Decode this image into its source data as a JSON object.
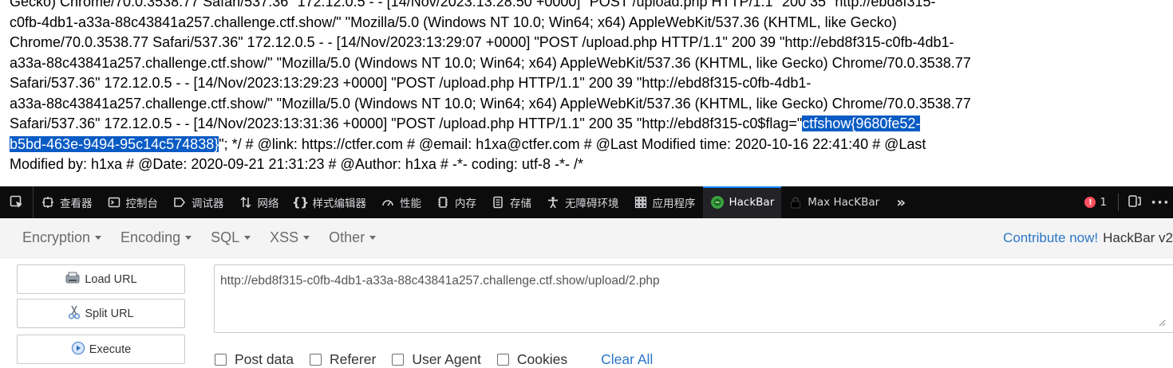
{
  "log": {
    "lines": [
      {
        "text": "Gecko) Chrome/70.0.3538.77 Safari/537.36\" 172.12.0.5 - - [14/Nov/2023:13:28:50 +0000] \"POST /upload.php HTTP/1.1\" 200 35 \"http://ebd8f315-"
      },
      {
        "text": "c0fb-4db1-a33a-88c43841a257.challenge.ctf.show/\" \"Mozilla/5.0 (Windows NT 10.0; Win64; x64) AppleWebKit/537.36 (KHTML, like Gecko)"
      },
      {
        "text": "Chrome/70.0.3538.77 Safari/537.36\" 172.12.0.5 - - [14/Nov/2023:13:29:07 +0000] \"POST /upload.php HTTP/1.1\" 200 39 \"http://ebd8f315-c0fb-4db1-"
      },
      {
        "text": "a33a-88c43841a257.challenge.ctf.show/\" \"Mozilla/5.0 (Windows NT 10.0; Win64; x64) AppleWebKit/537.36 (KHTML, like Gecko) Chrome/70.0.3538.77"
      },
      {
        "text": "Safari/537.36\" 172.12.0.5 - - [14/Nov/2023:13:29:23 +0000] \"POST /upload.php HTTP/1.1\" 200 39 \"http://ebd8f315-c0fb-4db1-"
      },
      {
        "text": "a33a-88c43841a257.challenge.ctf.show/\" \"Mozilla/5.0 (Windows NT 10.0; Win64; x64) AppleWebKit/537.36 (KHTML, like Gecko) Chrome/70.0.3538.77"
      },
      {
        "text": "Safari/537.36\" 172.12.0.5 - - [14/Nov/2023:13:31:36 +0000] \"POST /upload.php HTTP/1.1\" 200 35 \"http://ebd8f315-c0$flag=\"",
        "selected": "ctfshow{9680fe52-"
      },
      {
        "text": "",
        "selected": "b5bd-463e-9494-95c14c574838}",
        "after": "\"; */ # @link: https://ctfer.com # @email: h1xa@ctfer.com # @Last Modified time: 2020-10-16 22:41:40 # @Last"
      },
      {
        "text": "Modified by: h1xa # @Date: 2020-09-21 21:31:23 # @Author: h1xa # -*- coding: utf-8 -*- /*"
      }
    ]
  },
  "devtools": {
    "tabs": [
      {
        "label": "查看器",
        "icon": "inspector-icon"
      },
      {
        "label": "控制台",
        "icon": "console-icon"
      },
      {
        "label": "调试器",
        "icon": "debugger-icon"
      },
      {
        "label": "网络",
        "icon": "network-icon"
      },
      {
        "label": "样式编辑器",
        "icon": "style-editor-icon"
      },
      {
        "label": "性能",
        "icon": "performance-icon"
      },
      {
        "label": "内存",
        "icon": "memory-icon"
      },
      {
        "label": "存储",
        "icon": "storage-icon"
      },
      {
        "label": "无障碍环境",
        "icon": "accessibility-icon"
      },
      {
        "label": "应用程序",
        "icon": "application-icon"
      },
      {
        "label": "HackBar",
        "icon": "hackbar-icon",
        "active": true
      },
      {
        "label": "Max HacKBar",
        "icon": "lock-icon"
      }
    ],
    "error_count": "1"
  },
  "hackbar": {
    "menus": [
      "Encryption",
      "Encoding",
      "SQL",
      "XSS",
      "Other"
    ],
    "contribute": "Contribute now!",
    "version": "HackBar v2",
    "buttons": {
      "load": "Load URL",
      "split": "Split URL",
      "execute": "Execute"
    },
    "url": "http://ebd8f315-c0fb-4db1-a33a-88c43841a257.challenge.ctf.show/upload/2.php",
    "options": [
      "Post data",
      "Referer",
      "User Agent",
      "Cookies"
    ],
    "clear_all": "Clear All"
  }
}
